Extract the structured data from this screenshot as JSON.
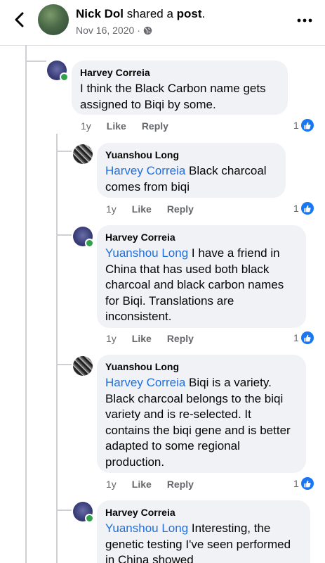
{
  "header": {
    "author_name": "Nick Dol",
    "action_text": " shared a ",
    "post_word": "post",
    "post_suffix": ".",
    "date": "Nov 16, 2020",
    "separator": "·"
  },
  "comments": [
    {
      "author": "Harvey Correia",
      "mention": "",
      "text": "I think the Black Carbon name gets assigned to Biqi by some.",
      "age": "1y",
      "like_label": "Like",
      "reply_label": "Reply",
      "reaction_count": "1",
      "online": true
    },
    {
      "author": "Yuanshou Long",
      "mention": "Harvey Correia",
      "text": " Black charcoal comes from biqi",
      "age": "1y",
      "like_label": "Like",
      "reply_label": "Reply",
      "reaction_count": "1",
      "online": false
    },
    {
      "author": "Harvey Correia",
      "mention": "Yuanshou Long",
      "text": " I have a friend in China that has used both black charcoal and black carbon names for Biqi.  Translations are inconsistent.",
      "age": "1y",
      "like_label": "Like",
      "reply_label": "Reply",
      "reaction_count": "1",
      "online": true
    },
    {
      "author": "Yuanshou Long",
      "mention": "Harvey Correia",
      "text": " Biqi is a variety. Black charcoal belongs to the biqi variety and is re-selected. It contains the biqi gene and is better adapted to some regional production.",
      "age": "1y",
      "like_label": "Like",
      "reply_label": "Reply",
      "reaction_count": "1",
      "online": false
    },
    {
      "author": "Harvey Correia",
      "mention": "Yuanshou Long",
      "text": " Interesting, the genetic testing I've seen performed in China showed",
      "online": true
    }
  ],
  "colors": {
    "mention": "#216fdb",
    "like_blue": "#1877f2",
    "online_green": "#31a24c",
    "bubble_bg": "#f0f2f5"
  },
  "icons": {
    "back": "chevron-left-icon",
    "privacy": "globe-icon",
    "more": "more-dots-icon",
    "reaction": "thumbs-up-icon"
  }
}
